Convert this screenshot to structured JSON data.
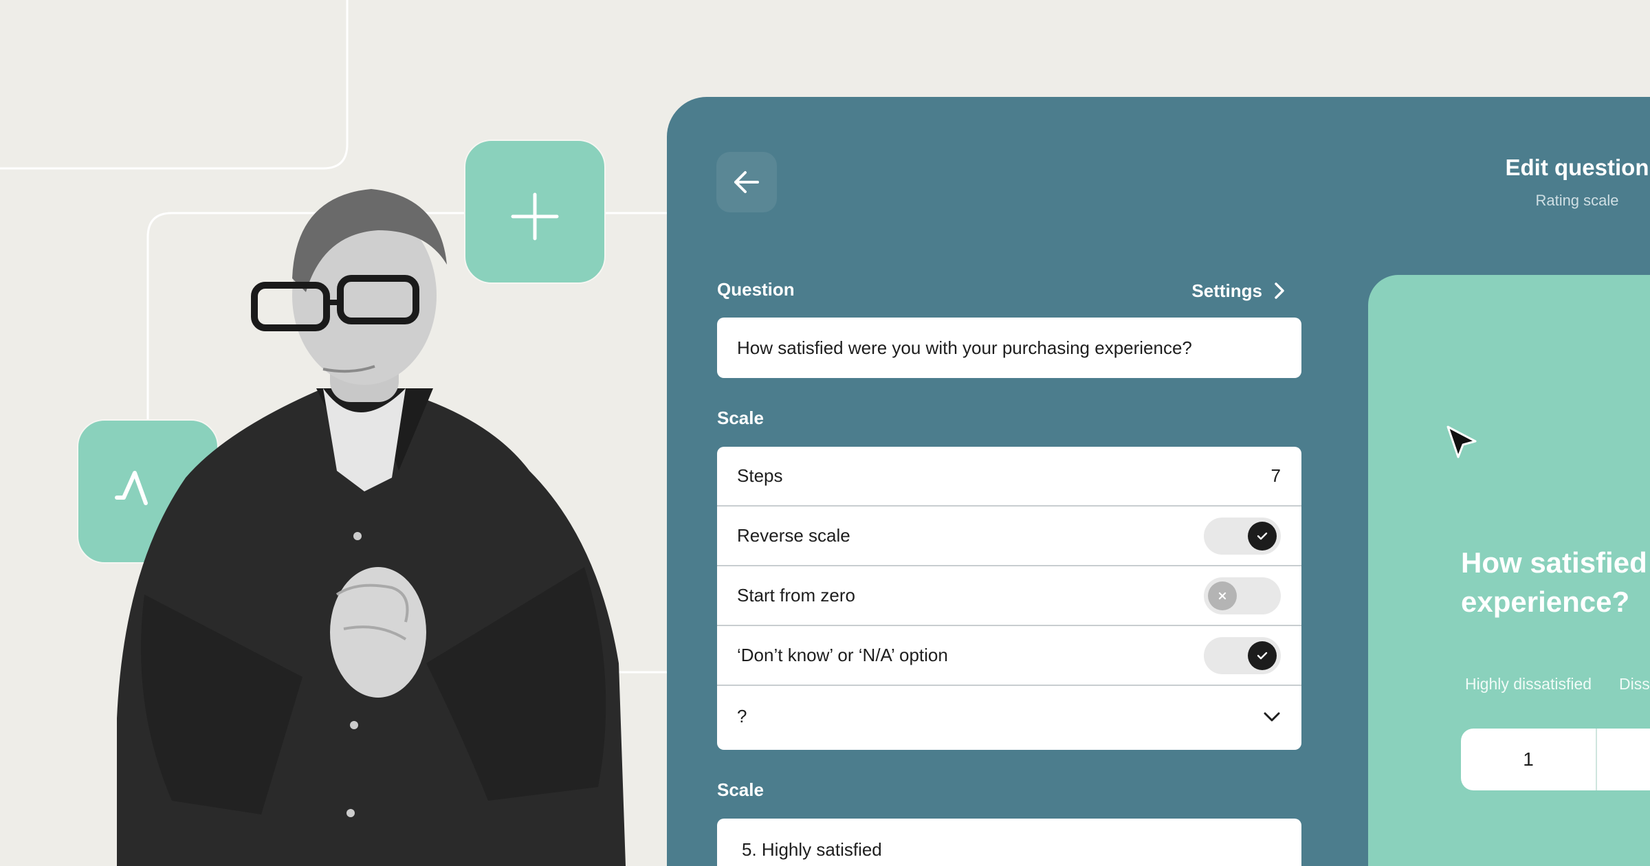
{
  "header": {
    "title": "Edit question",
    "subtitle": "Rating scale"
  },
  "question": {
    "label": "Question",
    "settings_label": "Settings",
    "value": "How satisfied were you with your purchasing experience?"
  },
  "scale_section": {
    "label": "Scale"
  },
  "options": {
    "steps_label": "Steps",
    "steps_value": "7",
    "reverse_label": "Reverse scale",
    "reverse_on": true,
    "zero_label": "Start from zero",
    "zero_on": false,
    "na_label": "‘Don’t know’ or ‘N/A’ option",
    "na_on": true,
    "dropdown_value": "?"
  },
  "scale_labels": {
    "label": "Scale",
    "first_item": "5. Highly satisfied"
  },
  "preview": {
    "question_line1": "How satisfied",
    "question_line2": "experience?",
    "label_1": "Highly dissatisfied",
    "label_2": "Diss",
    "value_1": "1"
  },
  "colors": {
    "background": "#eeede8",
    "panel": "#4c7d8d",
    "accent": "#8ad1bc"
  },
  "icons": [
    "plus-icon",
    "pulse-icon",
    "back-arrow-icon",
    "chevron-right-icon",
    "check-icon",
    "x-icon",
    "chevron-down-icon",
    "cursor-icon"
  ]
}
